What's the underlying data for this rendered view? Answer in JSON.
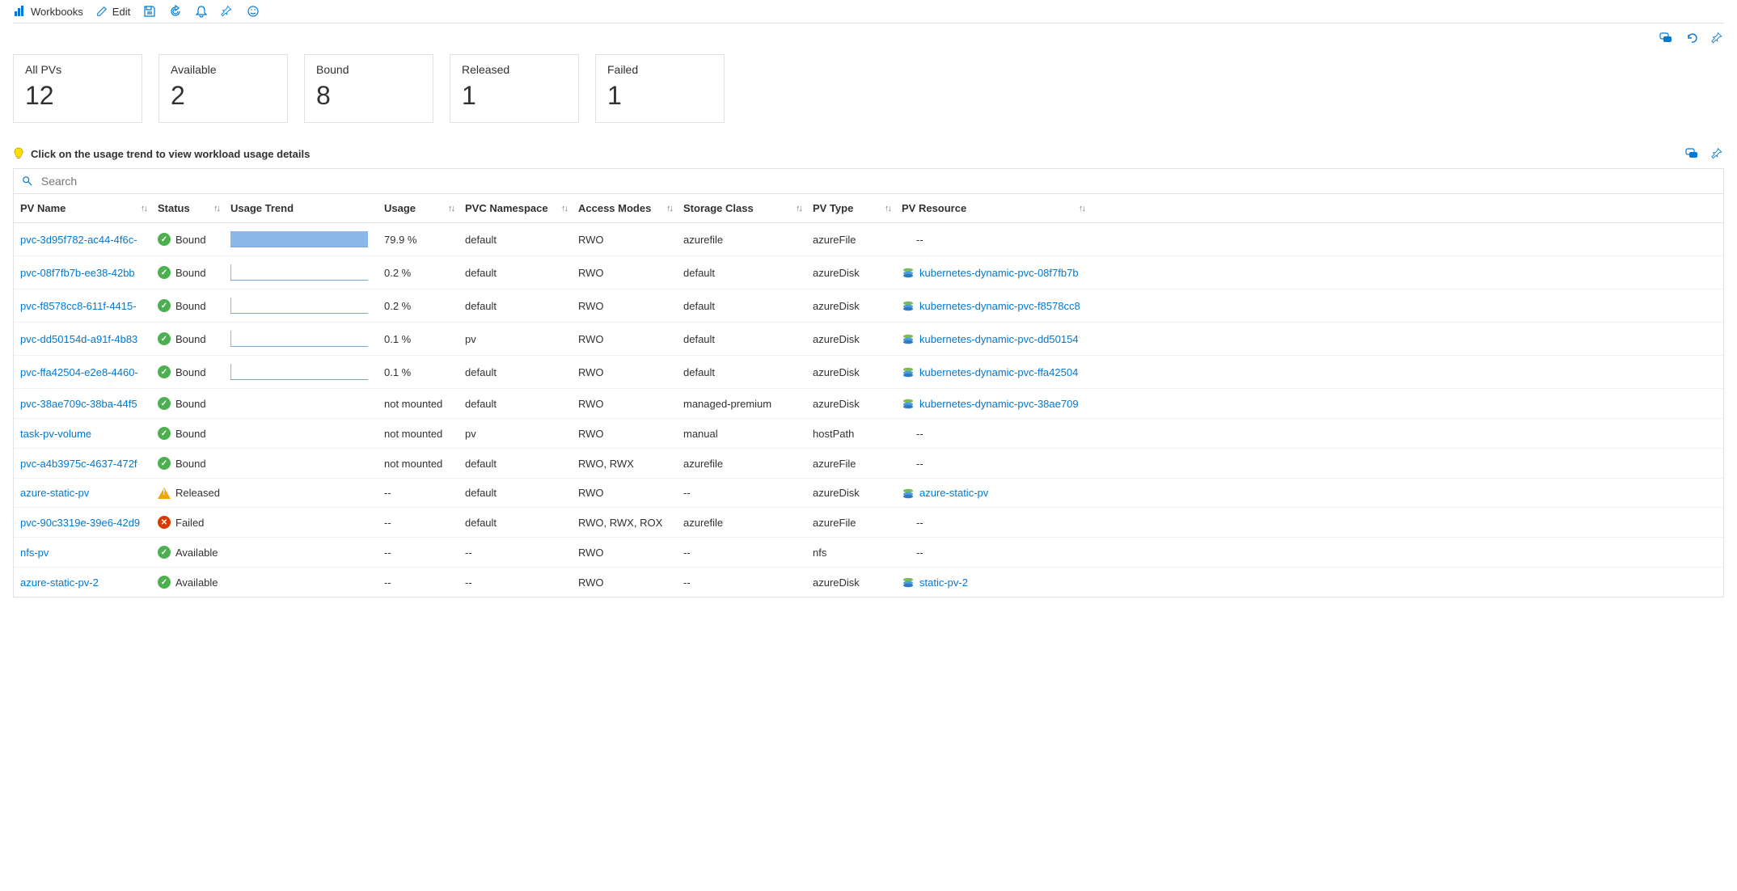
{
  "toolbar": {
    "workbooks_label": "Workbooks",
    "edit_label": "Edit"
  },
  "tiles": [
    {
      "label": "All PVs",
      "value": "12"
    },
    {
      "label": "Available",
      "value": "2"
    },
    {
      "label": "Bound",
      "value": "8"
    },
    {
      "label": "Released",
      "value": "1"
    },
    {
      "label": "Failed",
      "value": "1"
    }
  ],
  "hint_text": "Click on the usage trend to view workload usage details",
  "search_placeholder": "Search",
  "columns": {
    "pv_name": "PV Name",
    "status": "Status",
    "usage_trend": "Usage Trend",
    "usage": "Usage",
    "pvc_namespace": "PVC Namespace",
    "access_modes": "Access Modes",
    "storage_class": "Storage Class",
    "pv_type": "PV Type",
    "pv_resource": "PV Resource"
  },
  "rows": [
    {
      "name": "pvc-3d95f782-ac44-4f6c-",
      "status": "Bound",
      "status_icon": "ok",
      "trend_pct": 100,
      "usage": "79.9 %",
      "ns": "default",
      "modes": "RWO",
      "sclass": "azurefile",
      "ptype": "azureFile",
      "res_text": "--",
      "res_link": false
    },
    {
      "name": "pvc-08f7fb7b-ee38-42bb",
      "status": "Bound",
      "status_icon": "ok",
      "trend_pct": 0.3,
      "usage": "0.2 %",
      "ns": "default",
      "modes": "RWO",
      "sclass": "default",
      "ptype": "azureDisk",
      "res_text": "kubernetes-dynamic-pvc-08f7fb7b",
      "res_link": true
    },
    {
      "name": "pvc-f8578cc8-611f-4415-",
      "status": "Bound",
      "status_icon": "ok",
      "trend_pct": 0.3,
      "usage": "0.2 %",
      "ns": "default",
      "modes": "RWO",
      "sclass": "default",
      "ptype": "azureDisk",
      "res_text": "kubernetes-dynamic-pvc-f8578cc8",
      "res_link": true
    },
    {
      "name": "pvc-dd50154d-a91f-4b83",
      "status": "Bound",
      "status_icon": "ok",
      "trend_pct": 0.15,
      "usage": "0.1 %",
      "ns": "pv",
      "modes": "RWO",
      "sclass": "default",
      "ptype": "azureDisk",
      "res_text": "kubernetes-dynamic-pvc-dd50154",
      "res_link": true
    },
    {
      "name": "pvc-ffa42504-e2e8-4460-",
      "status": "Bound",
      "status_icon": "ok",
      "trend_pct": 0.15,
      "usage": "0.1 %",
      "ns": "default",
      "modes": "RWO",
      "sclass": "default",
      "ptype": "azureDisk",
      "res_text": "kubernetes-dynamic-pvc-ffa42504",
      "res_link": true
    },
    {
      "name": "pvc-38ae709c-38ba-44f5",
      "status": "Bound",
      "status_icon": "ok",
      "trend_pct": null,
      "usage": "not mounted",
      "ns": "default",
      "modes": "RWO",
      "sclass": "managed-premium",
      "ptype": "azureDisk",
      "res_text": "kubernetes-dynamic-pvc-38ae709",
      "res_link": true
    },
    {
      "name": "task-pv-volume",
      "status": "Bound",
      "status_icon": "ok",
      "trend_pct": null,
      "usage": "not mounted",
      "ns": "pv",
      "modes": "RWO",
      "sclass": "manual",
      "ptype": "hostPath",
      "res_text": "--",
      "res_link": false
    },
    {
      "name": "pvc-a4b3975c-4637-472f",
      "status": "Bound",
      "status_icon": "ok",
      "trend_pct": null,
      "usage": "not mounted",
      "ns": "default",
      "modes": "RWO, RWX",
      "sclass": "azurefile",
      "ptype": "azureFile",
      "res_text": "--",
      "res_link": false
    },
    {
      "name": "azure-static-pv",
      "status": "Released",
      "status_icon": "warn",
      "trend_pct": null,
      "usage": "--",
      "ns": "default",
      "modes": "RWO",
      "sclass": "--",
      "ptype": "azureDisk",
      "res_text": "azure-static-pv",
      "res_link": true
    },
    {
      "name": "pvc-90c3319e-39e6-42d9",
      "status": "Failed",
      "status_icon": "fail",
      "trend_pct": null,
      "usage": "--",
      "ns": "default",
      "modes": "RWO, RWX, ROX",
      "sclass": "azurefile",
      "ptype": "azureFile",
      "res_text": "--",
      "res_link": false
    },
    {
      "name": "nfs-pv",
      "status": "Available",
      "status_icon": "ok",
      "trend_pct": null,
      "usage": "--",
      "ns": "--",
      "modes": "RWO",
      "sclass": "--",
      "ptype": "nfs",
      "res_text": "--",
      "res_link": false
    },
    {
      "name": "azure-static-pv-2",
      "status": "Available",
      "status_icon": "ok",
      "trend_pct": null,
      "usage": "--",
      "ns": "--",
      "modes": "RWO",
      "sclass": "--",
      "ptype": "azureDisk",
      "res_text": "static-pv-2",
      "res_link": true
    }
  ]
}
